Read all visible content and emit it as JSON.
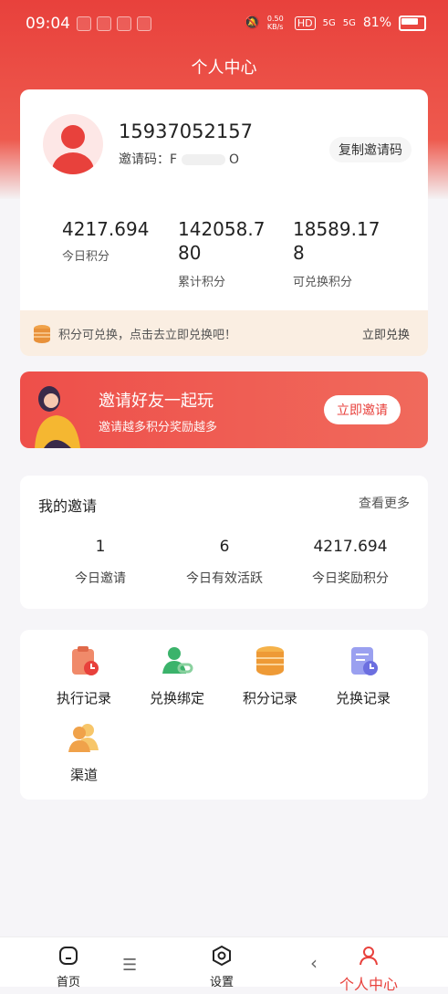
{
  "status_bar": {
    "time": "09:04",
    "speed": "0.50 KB/s",
    "hd": "HD",
    "signal1": "5G",
    "signal2": "5G",
    "battery": "81%"
  },
  "header": {
    "title": "个人中心"
  },
  "profile": {
    "phone": "15937052157",
    "invite_code_label": "邀请码：F",
    "invite_code_suffix": "O",
    "copy_button": "复制邀请码"
  },
  "stats": [
    {
      "value": "4217.694",
      "label": "今日积分"
    },
    {
      "value": "142058.780",
      "label": "累计积分"
    },
    {
      "value": "18589.178",
      "label": "可兑换积分"
    }
  ],
  "redeem_bar": {
    "text": "积分可兑换，点击去立即兑换吧！",
    "action": "立即兑换"
  },
  "invite_banner": {
    "title": "邀请好友一起玩",
    "subtitle": "邀请越多积分奖励越多",
    "button": "立即邀请"
  },
  "my_invite": {
    "title": "我的邀请",
    "more": "查看更多",
    "stats": [
      {
        "value": "1",
        "label": "今日邀请"
      },
      {
        "value": "6",
        "label": "今日有效活跃"
      },
      {
        "value": "4217.694",
        "label": "今日奖励积分"
      }
    ]
  },
  "menu": [
    {
      "label": "执行记录",
      "icon": "clipboard-clock-icon"
    },
    {
      "label": "兑换绑定",
      "icon": "user-link-icon"
    },
    {
      "label": "积分记录",
      "icon": "coins-stack-icon"
    },
    {
      "label": "兑换记录",
      "icon": "document-clock-icon"
    },
    {
      "label": "渠道",
      "icon": "users-icon"
    }
  ],
  "tabbar": [
    {
      "label": "首页",
      "icon": "home-icon"
    },
    {
      "label": "设置",
      "icon": "hexagon-settings-icon"
    },
    {
      "label": "个人中心",
      "icon": "person-icon"
    }
  ],
  "colors": {
    "brand_red": "#e8413c",
    "coin_orange": "#f0a24a",
    "icon_purple": "#6c6fe0",
    "icon_green": "#3bb36b"
  }
}
